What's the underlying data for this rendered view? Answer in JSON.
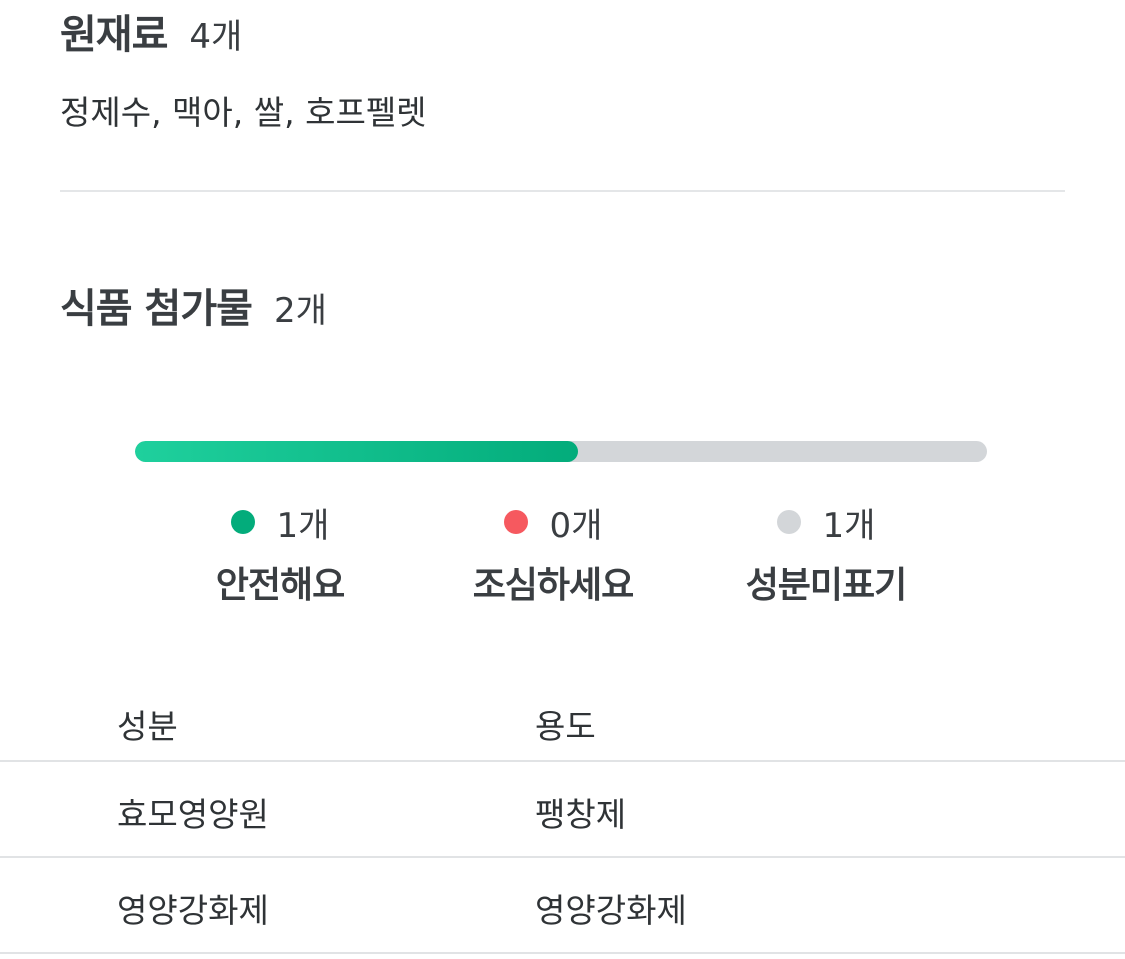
{
  "ingredients": {
    "title": "원재료",
    "count": "4개",
    "list": "정제수, 맥아, 쌀, 호프펠렛"
  },
  "additives": {
    "title": "식품 첨가물",
    "count": "2개",
    "ratio": {
      "safe_fraction": 0.52,
      "fill_color": "#03ac7b",
      "track_color": "#d3d6d9"
    },
    "legend": [
      {
        "count": "1개",
        "label": "안전해요",
        "color": "#03ac7b"
      },
      {
        "count": "0개",
        "label": "조심하세요",
        "color": "#f6595f"
      },
      {
        "count": "1개",
        "label": "성분미표기",
        "color": "#d3d6d9"
      }
    ],
    "table": {
      "headers": [
        "성분",
        "용도"
      ],
      "rows": [
        [
          "효모영양원",
          "팽창제"
        ],
        [
          "영양강화제",
          "영양강화제"
        ]
      ]
    }
  }
}
